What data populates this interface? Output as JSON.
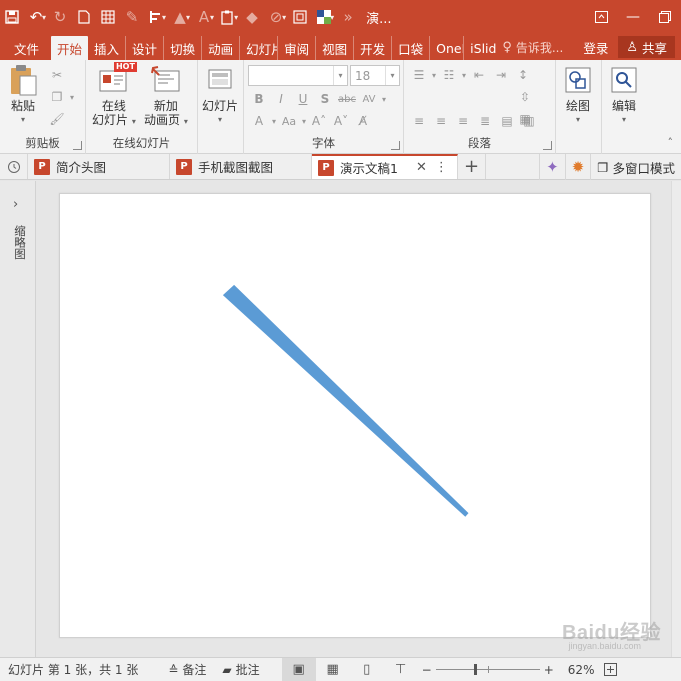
{
  "app": {
    "doc_title": "演...",
    "accent": "#c7472d",
    "shape_color": "#5b9bd5"
  },
  "qat": [
    "save-icon",
    "undo-icon",
    "redo-icon",
    "new-icon",
    "table-icon",
    "eyedropper-icon",
    "align-icon",
    "highlight-icon",
    "font-color-icon",
    "paste-options-icon",
    "eraser-icon",
    "shapes-icon",
    "fit-icon",
    "color-icon",
    "more-icon"
  ],
  "tabs": {
    "file": "文件",
    "items": [
      "开始",
      "插入",
      "设计",
      "切换",
      "动画",
      "幻灯片",
      "审阅",
      "视图",
      "开发",
      "口袋",
      "OneN",
      "iSlide"
    ],
    "active": "开始",
    "tell_me": "告诉我...",
    "login": "登录",
    "share": "共享"
  },
  "ribbon": {
    "clipboard": {
      "paste": "粘贴",
      "label": "剪贴板"
    },
    "online_slides": {
      "online_slide_line1": "在线",
      "online_slide_line2": "幻灯片",
      "hot": "HOT",
      "new_anim_line1": "新加",
      "new_anim_line2": "动画页",
      "label": "在线幻灯片"
    },
    "slides": {
      "slide_btn": "幻灯片"
    },
    "font": {
      "size": "18",
      "label": "字体"
    },
    "paragraph": {
      "label": "段落"
    },
    "drawing": {
      "label": "绘图"
    },
    "editing": {
      "label": "编辑"
    }
  },
  "doc_tabs": {
    "items": [
      {
        "label": "简介头图",
        "active": false
      },
      {
        "label": "手机截图截图",
        "active": false
      },
      {
        "label": "演示文稿1",
        "active": true
      }
    ],
    "multi_window": "多窗口模式"
  },
  "thumb_pane": {
    "label": "缩略图"
  },
  "status": {
    "slide_info": "幻灯片 第 1 张，共 1 张",
    "notes": "备注",
    "comments": "批注",
    "zoom": "62%",
    "zoom_fraction": 0.38
  },
  "watermark": {
    "text": "Baidu经验",
    "sub": "jingyan.baidu.com"
  }
}
